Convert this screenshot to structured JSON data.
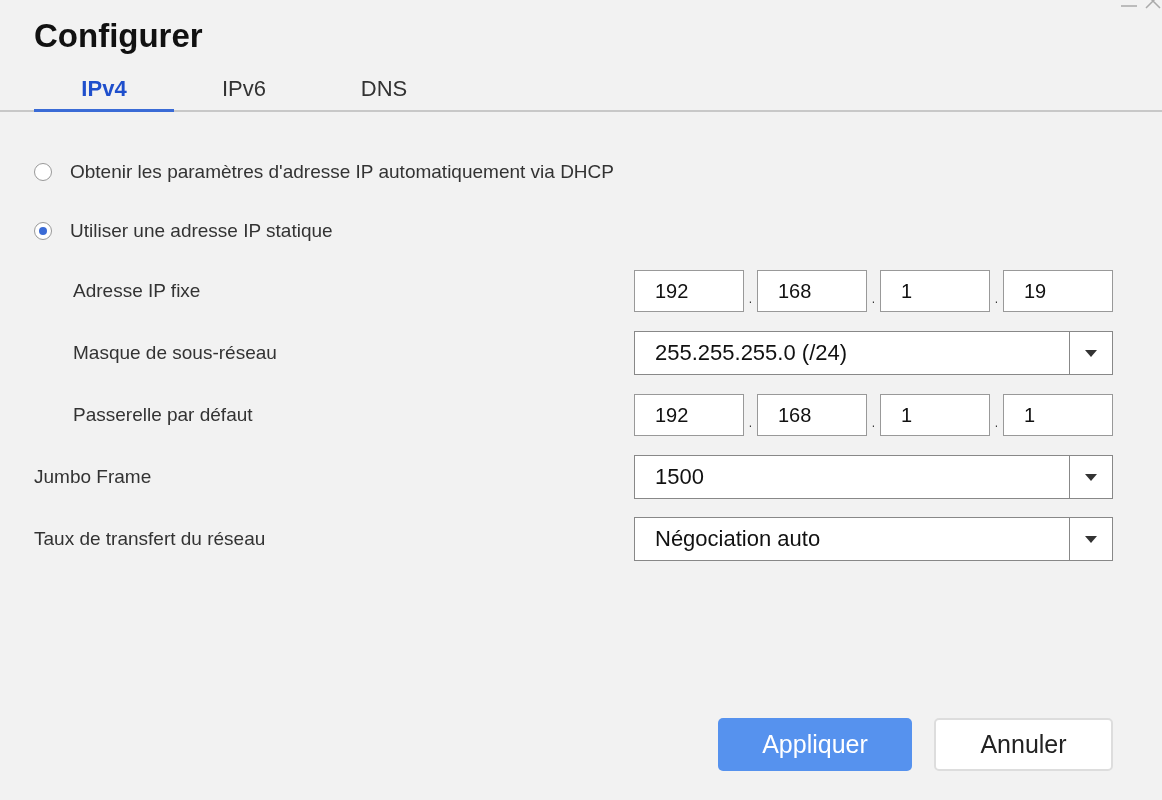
{
  "window": {
    "title": "Configurer"
  },
  "tabs": [
    {
      "label": "IPv4",
      "selected": true
    },
    {
      "label": "IPv6",
      "selected": false
    },
    {
      "label": "DNS",
      "selected": false
    }
  ],
  "ip_modes": [
    {
      "label": "Obtenir les paramètres d'adresse IP automatiquement via DHCP",
      "selected": false
    },
    {
      "label": "Utiliser une adresse IP statique",
      "selected": true,
      "fields": [
        {
          "label": "Adresse IP fixe",
          "kind": "ip",
          "separator": ".",
          "parts": [
            "192",
            "168",
            "1",
            "19"
          ]
        },
        {
          "label": "Masque de sous-réseau",
          "kind": "select",
          "value": "255.255.255.0 (/24)"
        },
        {
          "label": "Passerelle par défaut",
          "kind": "ip",
          "separator": ".",
          "parts": [
            "192",
            "168",
            "1",
            "1"
          ]
        }
      ]
    }
  ],
  "fields": [
    {
      "label": "Jumbo Frame",
      "kind": "select",
      "value": "1500"
    },
    {
      "label": "Taux de transfert du réseau",
      "kind": "select",
      "value": "Négociation auto"
    }
  ],
  "buttons": [
    {
      "label": "Appliquer",
      "kind": "primary"
    },
    {
      "label": "Annuler",
      "kind": "secondary"
    }
  ]
}
